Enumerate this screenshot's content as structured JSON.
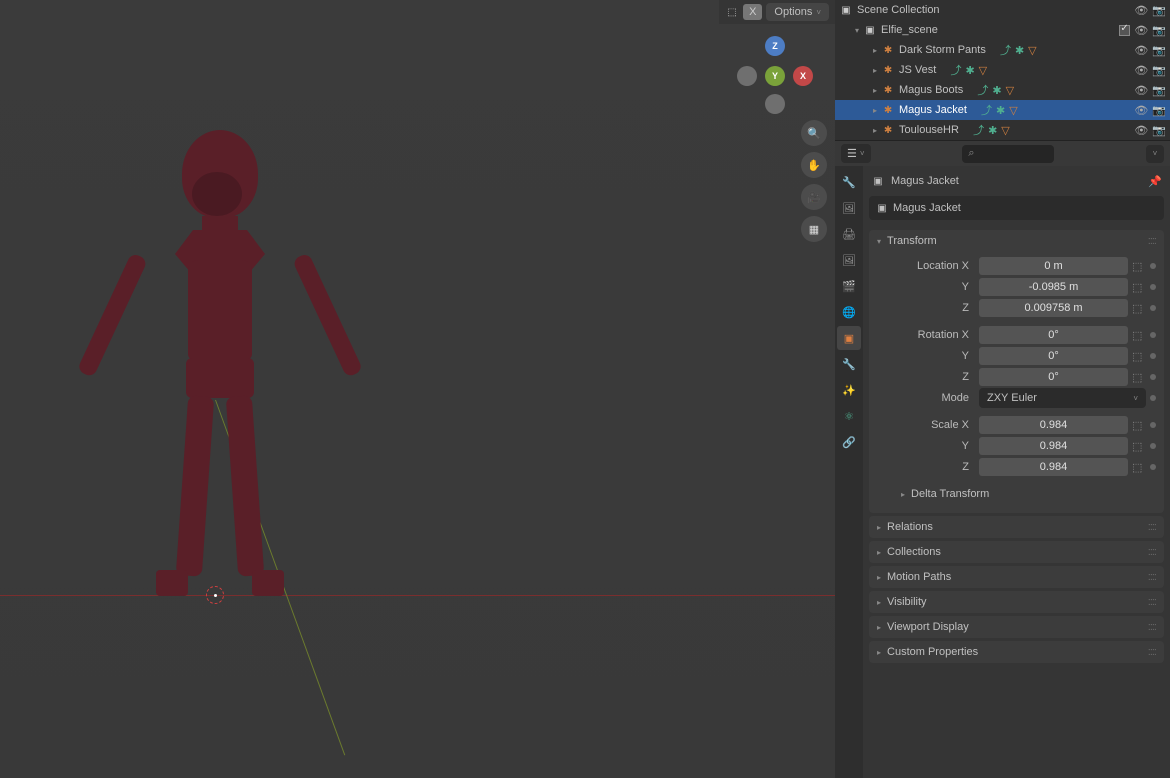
{
  "header": {
    "options_label": "Options",
    "gizmo": {
      "x": "X",
      "y": "Y",
      "z": "Z"
    }
  },
  "outliner": {
    "root": "Scene Collection",
    "scene": "Elfie_scene",
    "items": [
      {
        "label": "Dark Storm Pants"
      },
      {
        "label": "JS Vest"
      },
      {
        "label": "Magus Boots"
      },
      {
        "label": "Magus Jacket"
      },
      {
        "label": "ToulouseHR"
      }
    ]
  },
  "properties": {
    "breadcrumb": "Magus Jacket",
    "name_field": "Magus Jacket",
    "transform": {
      "title": "Transform",
      "loc_label": "Location X",
      "loc_x": "0 m",
      "loc_y": "-0.0985 m",
      "loc_z": "0.009758 m",
      "rot_label": "Rotation X",
      "rot_x": "0°",
      "rot_y": "0°",
      "rot_z": "0°",
      "y_label": "Y",
      "z_label": "Z",
      "mode_label": "Mode",
      "mode_value": "ZXY Euler",
      "scale_label": "Scale X",
      "scale_x": "0.984",
      "scale_y": "0.984",
      "scale_z": "0.984",
      "delta": "Delta Transform"
    },
    "panels": {
      "relations": "Relations",
      "collections": "Collections",
      "motion_paths": "Motion Paths",
      "visibility": "Visibility",
      "viewport_display": "Viewport Display",
      "custom_properties": "Custom Properties"
    }
  }
}
